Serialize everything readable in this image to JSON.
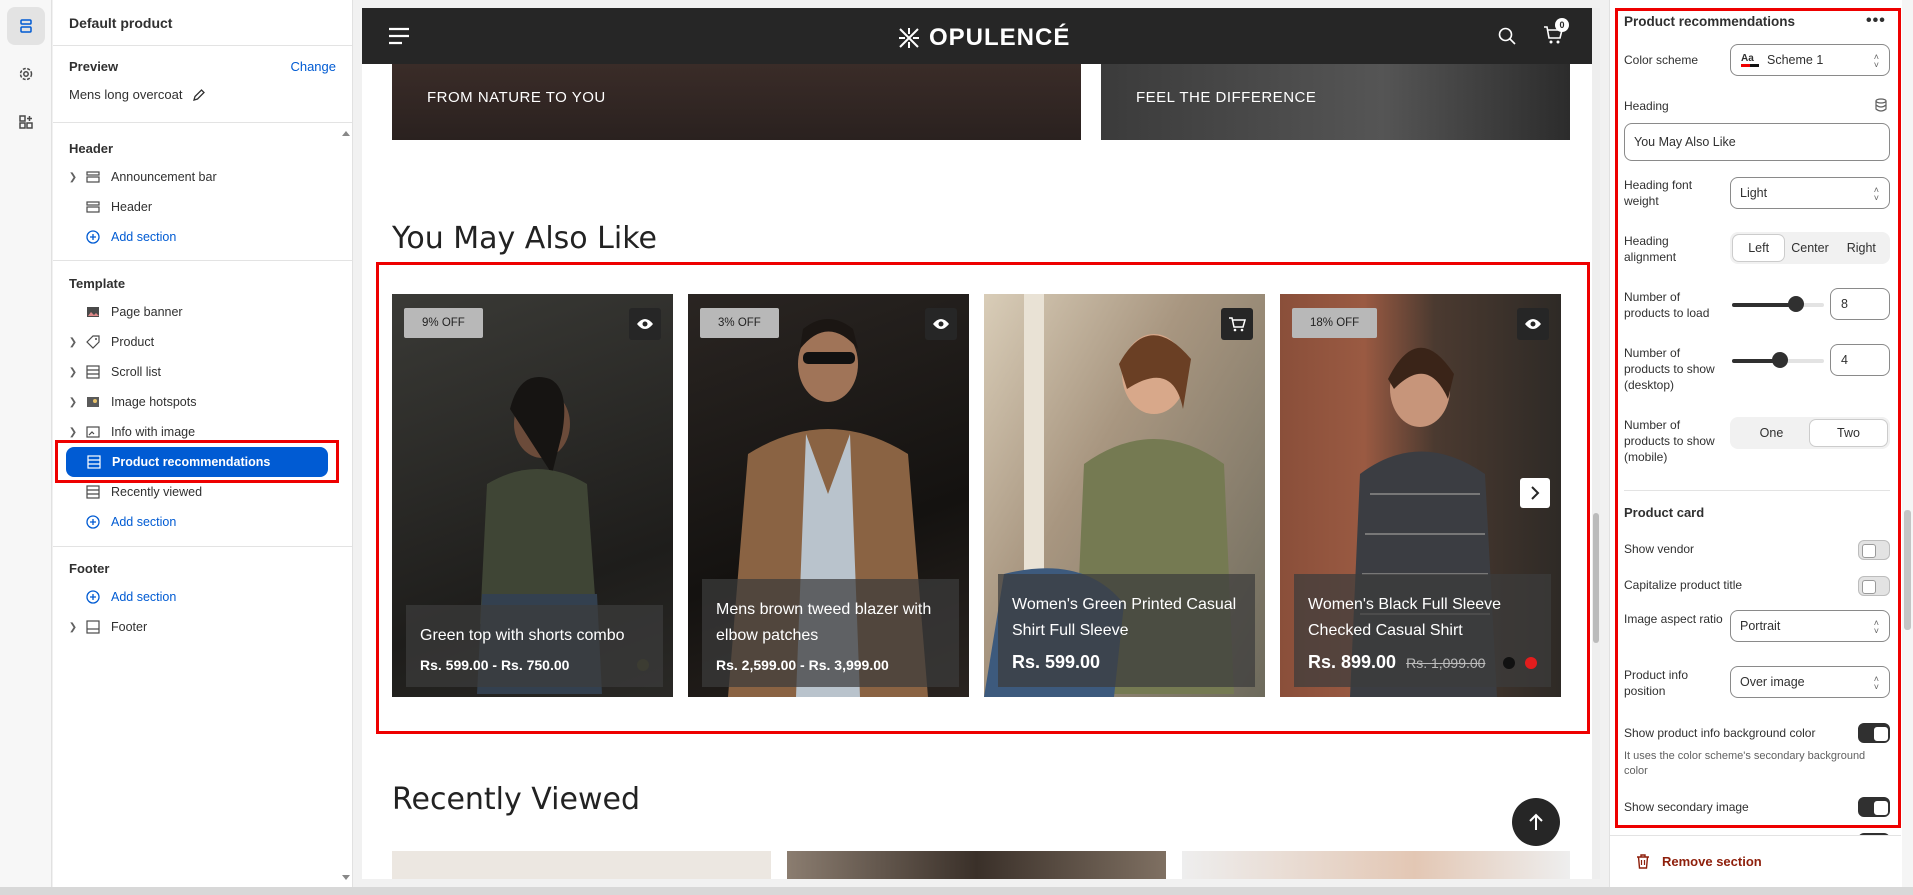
{
  "editor": {
    "page_title": "Default product",
    "preview_label": "Preview",
    "change_label": "Change",
    "preview_product": "Mens long overcoat"
  },
  "sidebar": {
    "header_group": "Header",
    "header_items": [
      "Announcement bar",
      "Header"
    ],
    "add_section": "Add section",
    "template_group": "Template",
    "template_items": [
      "Page banner",
      "Product",
      "Scroll list",
      "Image hotspots",
      "Info with image",
      "Product recommendations",
      "Recently viewed"
    ],
    "footer_group": "Footer",
    "footer_items": [
      "Footer"
    ]
  },
  "store": {
    "brand": "OPULENCÉ",
    "cart_count": "0",
    "banners": [
      "FROM NATURE TO YOU",
      "FEEL THE DIFFERENCE"
    ],
    "section_heading": "You May Also Like",
    "recent_heading": "Recently Viewed",
    "products": [
      {
        "badge": "9% OFF",
        "title": "Green top with shorts combo",
        "price": "Rs. 599.00 - Rs. 750.00",
        "compare": ""
      },
      {
        "badge": "3% OFF",
        "title": "Mens brown tweed blazer with elbow patches",
        "price": "Rs. 2,599.00 - Rs. 3,999.00",
        "compare": ""
      },
      {
        "badge": "",
        "title": "Women's Green Printed Casual Shirt Full Sleeve",
        "price": "Rs. 599.00",
        "compare": ""
      },
      {
        "badge": "18% OFF",
        "title": "Women's Black Full Sleeve Checked Casual Shirt",
        "price": "Rs. 899.00",
        "compare": "Rs. 1,099.00"
      }
    ]
  },
  "settings": {
    "title": "Product recommendations",
    "color_scheme_label": "Color scheme",
    "color_scheme_value": "Scheme 1",
    "heading_label": "Heading",
    "heading_value": "You May Also Like",
    "font_weight_label": "Heading font weight",
    "font_weight_value": "Light",
    "alignment_label": "Heading alignment",
    "alignment_options": [
      "Left",
      "Center",
      "Right"
    ],
    "alignment_selected": "Left",
    "products_load_label": "Number of products to load",
    "products_load_value": "8",
    "products_desktop_label": "Number of products to show (desktop)",
    "products_desktop_value": "4",
    "products_mobile_label": "Number of products to show (mobile)",
    "mobile_options": [
      "One",
      "Two"
    ],
    "mobile_selected": "Two",
    "product_card_heading": "Product card",
    "show_vendor_label": "Show vendor",
    "show_vendor": false,
    "capitalize_label": "Capitalize product title",
    "capitalize": false,
    "aspect_label": "Image aspect ratio",
    "aspect_value": "Portrait",
    "info_position_label": "Product info position",
    "info_position_value": "Over image",
    "info_bg_label": "Show product info background color",
    "info_bg": true,
    "info_bg_help": "It uses the color scheme's secondary background color",
    "secondary_image_label": "Show secondary image",
    "secondary_image": true,
    "remove_label": "Remove section"
  },
  "colors": {
    "accent": "#005bd3",
    "highlight": "#e00000",
    "dark": "#262626"
  }
}
